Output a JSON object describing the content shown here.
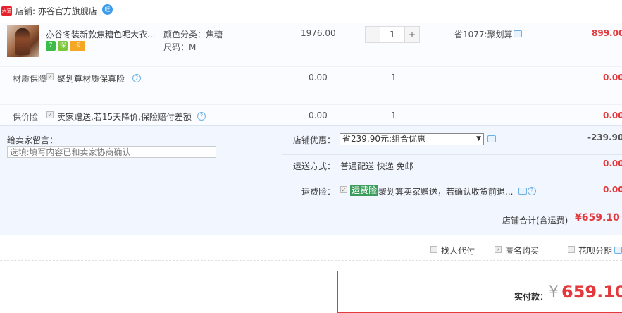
{
  "shop": {
    "badge": "天猫",
    "name": "店铺: 亦谷官方旗舰店",
    "ww": "旺"
  },
  "item": {
    "title": "亦谷冬装新款焦糖色呢大衣...",
    "badges": [
      "7",
      "保",
      "卡"
    ],
    "sku_color": "颜色分类：焦糖",
    "sku_size": "尺码：M",
    "price": "1976.00",
    "qty_minus": "-",
    "qty_value": "1",
    "qty_plus": "+",
    "promo": "省1077:聚划算",
    "subtotal": "899.00"
  },
  "services": [
    {
      "label": "材质保障",
      "text": "聚划算材质保真险",
      "price": "0.00",
      "qty": "1",
      "total": "0.00"
    },
    {
      "label": "保价险",
      "text": "卖家赠送,若15天降价,保险赔付差额",
      "price": "0.00",
      "qty": "1",
      "total": "0.00"
    }
  ],
  "message": {
    "label": "给卖家留言：",
    "placeholder": "选填:填写内容已和卖家协商确认"
  },
  "discount": {
    "label": "店铺优惠：",
    "selected": "省239.90元:组合优惠",
    "amount": "-239.90"
  },
  "shipping": {
    "label": "运送方式：",
    "text": "普通配送 快递 免邮",
    "amount": "0.00"
  },
  "freight_insurance": {
    "label": "运费险：",
    "tag": "运费险",
    "text": "聚划算卖家赠送，若确认收货前退...",
    "amount": "0.00"
  },
  "shop_total": {
    "label": "店铺合计(含运费)",
    "amount": "¥659.10"
  },
  "options": {
    "proxy_pay": "找人代付",
    "anonymous": "匿名购买",
    "installment": "花呗分期"
  },
  "payment": {
    "label": "实付款：",
    "currency": "¥",
    "amount": "659.10"
  },
  "colors": {
    "accent_red": "#e4393c",
    "panel_blue": "#f2f7ff",
    "link_blue": "#3d9be9"
  }
}
